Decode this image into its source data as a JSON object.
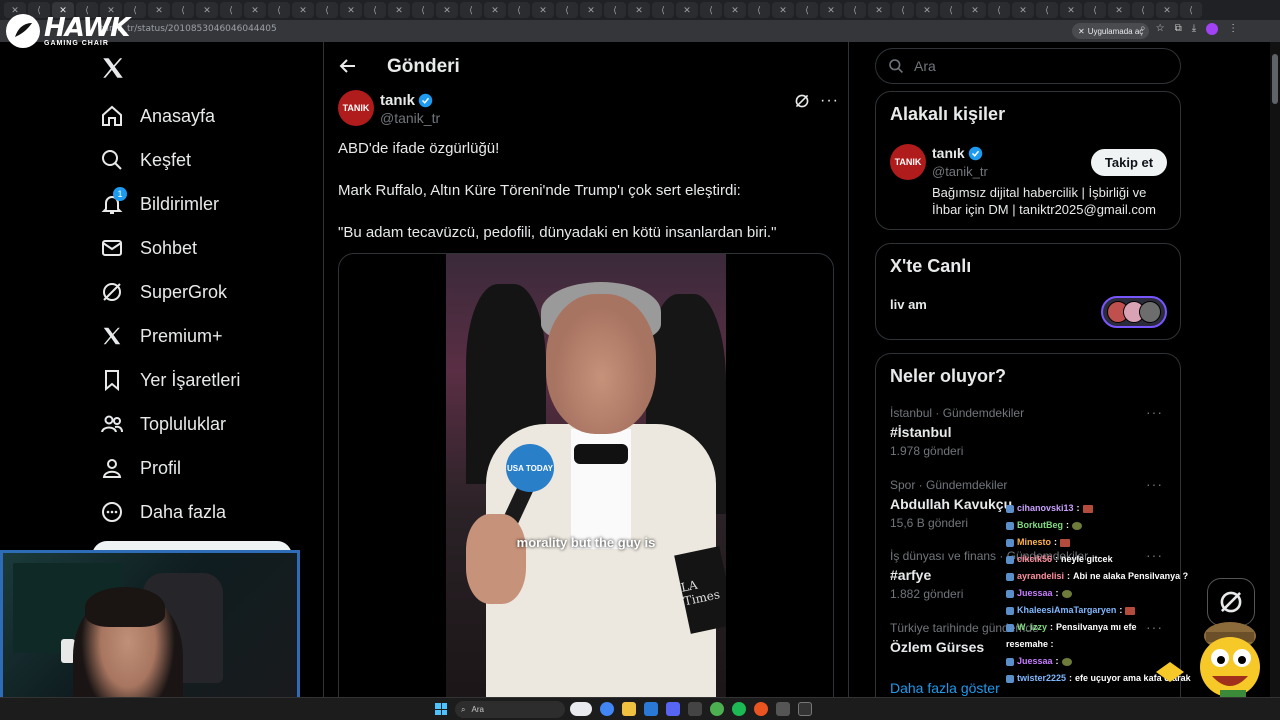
{
  "browser": {
    "url": "tanik_tr/status/2010853046046044405",
    "open_in_app": "Uygulamada aç"
  },
  "overlay": {
    "brand": "HAWK",
    "brand_sub": "GAMING CHAIR"
  },
  "nav": {
    "items": [
      {
        "label": "Anasayfa",
        "icon": "home-icon"
      },
      {
        "label": "Keşfet",
        "icon": "search-icon"
      },
      {
        "label": "Bildirimler",
        "icon": "bell-icon",
        "badge": "1"
      },
      {
        "label": "Sohbet",
        "icon": "mail-icon"
      },
      {
        "label": "SuperGrok",
        "icon": "grok-icon"
      },
      {
        "label": "Premium+",
        "icon": "x-icon"
      },
      {
        "label": "Yer İşaretleri",
        "icon": "bookmark-icon"
      },
      {
        "label": "Topluluklar",
        "icon": "people-icon"
      },
      {
        "label": "Profil",
        "icon": "person-icon"
      },
      {
        "label": "Daha fazla",
        "icon": "more-circle-icon"
      }
    ]
  },
  "post": {
    "header_title": "Gönderi",
    "author_name": "tanık",
    "author_handle": "@tanik_tr",
    "avatar_text": "TANIK",
    "text_lines": [
      "ABD'de ifade özgürlüğü!",
      "Mark Ruffalo, Altın Küre Töreni'nde Trump'ı çok sert eleştirdi:",
      "\"Bu adam tecavüzcü, pedofili, dünyadaki en kötü insanlardan biri.\""
    ],
    "video_caption": "morality but the guy is",
    "mic_label": "USA TODAY",
    "sign_label": "LA Times"
  },
  "sidebar": {
    "search_placeholder": "Ara",
    "related": {
      "title": "Alakalı kişiler",
      "name": "tanık",
      "handle": "@tanik_tr",
      "avatar_text": "TANIK",
      "bio": "Bağımsız dijital habercilik | İşbirliği ve İhbar için DM | taniktr2025@gmail.com",
      "follow_label": "Takip et"
    },
    "live": {
      "title": "X'te Canlı",
      "host": "liv am"
    },
    "trends": {
      "title": "Neler oluyor?",
      "items": [
        {
          "meta": "İstanbul · Gündemdekiler",
          "title": "#İstanbul",
          "count": "1.978 gönderi"
        },
        {
          "meta": "Spor · Gündemdekiler",
          "title": "Abdullah Kavukçu",
          "count": "15,6 B gönderi"
        },
        {
          "meta": "İş dünyası ve finans · Gündemdekiler",
          "title": "#arfye",
          "count": "1.882 gönderi"
        },
        {
          "meta": "Türkiye tarihinde gündemde",
          "title": "Özlem Gürses",
          "count": ""
        }
      ],
      "show_more": "Daha fazla göster"
    }
  },
  "chat": [
    {
      "user": "cihanovski13",
      "color": "#c9a0ff",
      "msg": ""
    },
    {
      "user": "BorkutBeg",
      "color": "#7fdc7f",
      "msg": ""
    },
    {
      "user": "Minesto",
      "color": "#ffb347",
      "msg": ""
    },
    {
      "user": "cikcik56",
      "color": "#ff8fa0",
      "msg": "neyle gitcek"
    },
    {
      "user": "ayrandelisi",
      "color": "#ff8fa0",
      "msg": "Abi ne alaka Pensilvanya ?"
    },
    {
      "user": "Juessaa",
      "color": "#c77dff",
      "msg": ""
    },
    {
      "user": "KhaleesiAmaTargaryen",
      "color": "#7fb8ff",
      "msg": ""
    },
    {
      "user": "W_izzy",
      "color": "#7fdc7f",
      "msg": "Pensilvanya mı efe"
    },
    {
      "user": "",
      "color": "#ffffff",
      "msg": "resemahe :"
    },
    {
      "user": "Juessaa",
      "color": "#c77dff",
      "msg": ""
    },
    {
      "user": "twister2225",
      "color": "#7fb8ff",
      "msg": "efe uçuyor ama kafa olarak"
    }
  ],
  "taskbar": {
    "search_label": "Ara"
  },
  "colors": {
    "accent": "#1d9bf0",
    "avatar_red": "#b01b1b",
    "webcam_border": "#2e6cb7"
  }
}
